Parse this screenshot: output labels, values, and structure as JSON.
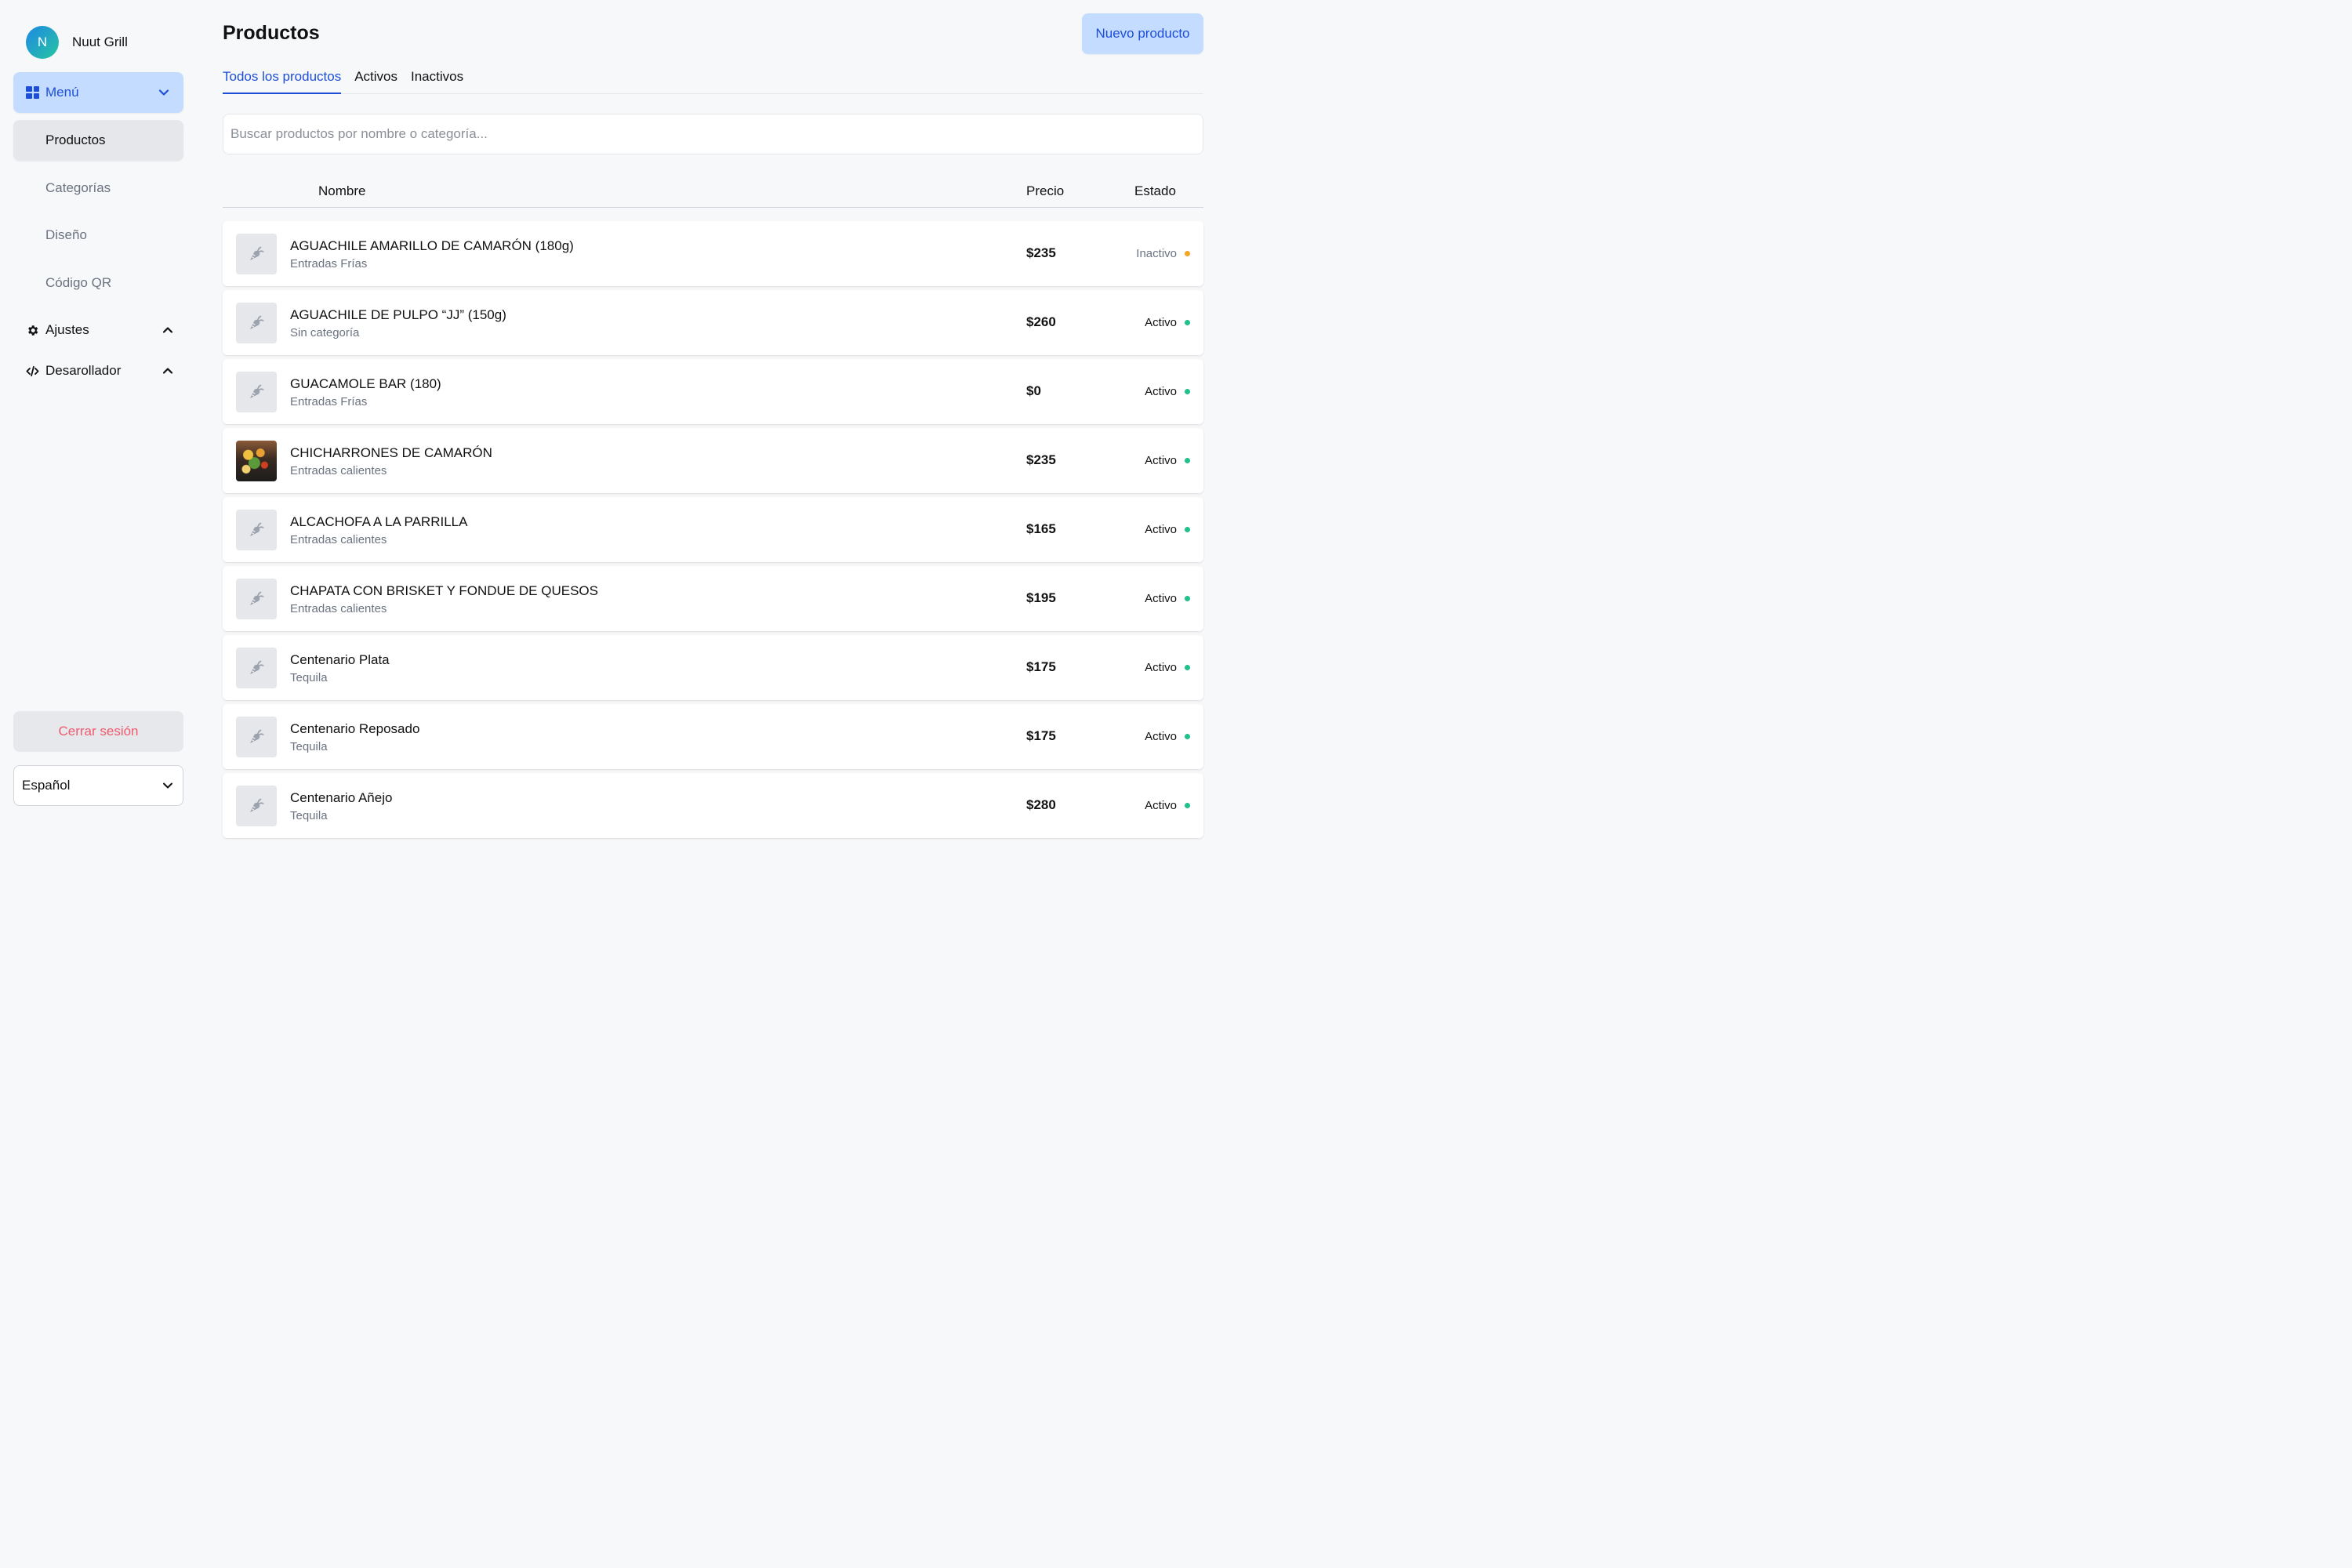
{
  "brand": {
    "initial": "N",
    "name": "Nuut Grill"
  },
  "sidebar": {
    "menu_label": "Menú",
    "sub_items": [
      "Productos",
      "Categorías",
      "Diseño",
      "Código QR"
    ],
    "settings_label": "Ajustes",
    "developer_label": "Desarollador",
    "logout_label": "Cerrar sesión",
    "language": "Español"
  },
  "header": {
    "title": "Productos",
    "new_button": "Nuevo producto"
  },
  "tabs": [
    "Todos los productos",
    "Activos",
    "Inactivos"
  ],
  "search": {
    "placeholder": "Buscar productos por nombre o categoría..."
  },
  "table": {
    "columns": {
      "name": "Nombre",
      "price": "Precio",
      "status": "Estado"
    },
    "rows": [
      {
        "name": "AGUACHILE AMARILLO DE CAMARÓN (180g)",
        "category": "Entradas Frías",
        "price": "$235",
        "status": "Inactivo",
        "has_photo": false
      },
      {
        "name": "AGUACHILE DE PULPO “JJ” (150g)",
        "category": "Sin categoría",
        "price": "$260",
        "status": "Activo",
        "has_photo": false
      },
      {
        "name": "GUACAMOLE BAR (180)",
        "category": "Entradas Frías",
        "price": "$0",
        "status": "Activo",
        "has_photo": false
      },
      {
        "name": "CHICHARRONES DE CAMARÓN",
        "category": "Entradas calientes",
        "price": "$235",
        "status": "Activo",
        "has_photo": true
      },
      {
        "name": "ALCACHOFA A LA PARRILLA",
        "category": "Entradas calientes",
        "price": "$165",
        "status": "Activo",
        "has_photo": false
      },
      {
        "name": "CHAPATA CON BRISKET Y FONDUE DE QUESOS",
        "category": "Entradas calientes",
        "price": "$195",
        "status": "Activo",
        "has_photo": false
      },
      {
        "name": "Centenario Plata",
        "category": "Tequila",
        "price": "$175",
        "status": "Activo",
        "has_photo": false
      },
      {
        "name": "Centenario Reposado",
        "category": "Tequila",
        "price": "$175",
        "status": "Activo",
        "has_photo": false
      },
      {
        "name": "Centenario Añejo",
        "category": "Tequila",
        "price": "$280",
        "status": "Activo",
        "has_photo": false
      }
    ]
  },
  "colors": {
    "accent": "#1d4ed8",
    "accent_bg": "#c3dcff",
    "active_dot": "#22c08a",
    "inactive_dot": "#f5a524",
    "logout_text": "#f05a6e"
  },
  "icons": {
    "menu": "grid-icon",
    "settings": "gear-icon",
    "developer": "code-icon",
    "placeholder_thumb": "carrot-icon",
    "chevron": "chevron-icon"
  }
}
